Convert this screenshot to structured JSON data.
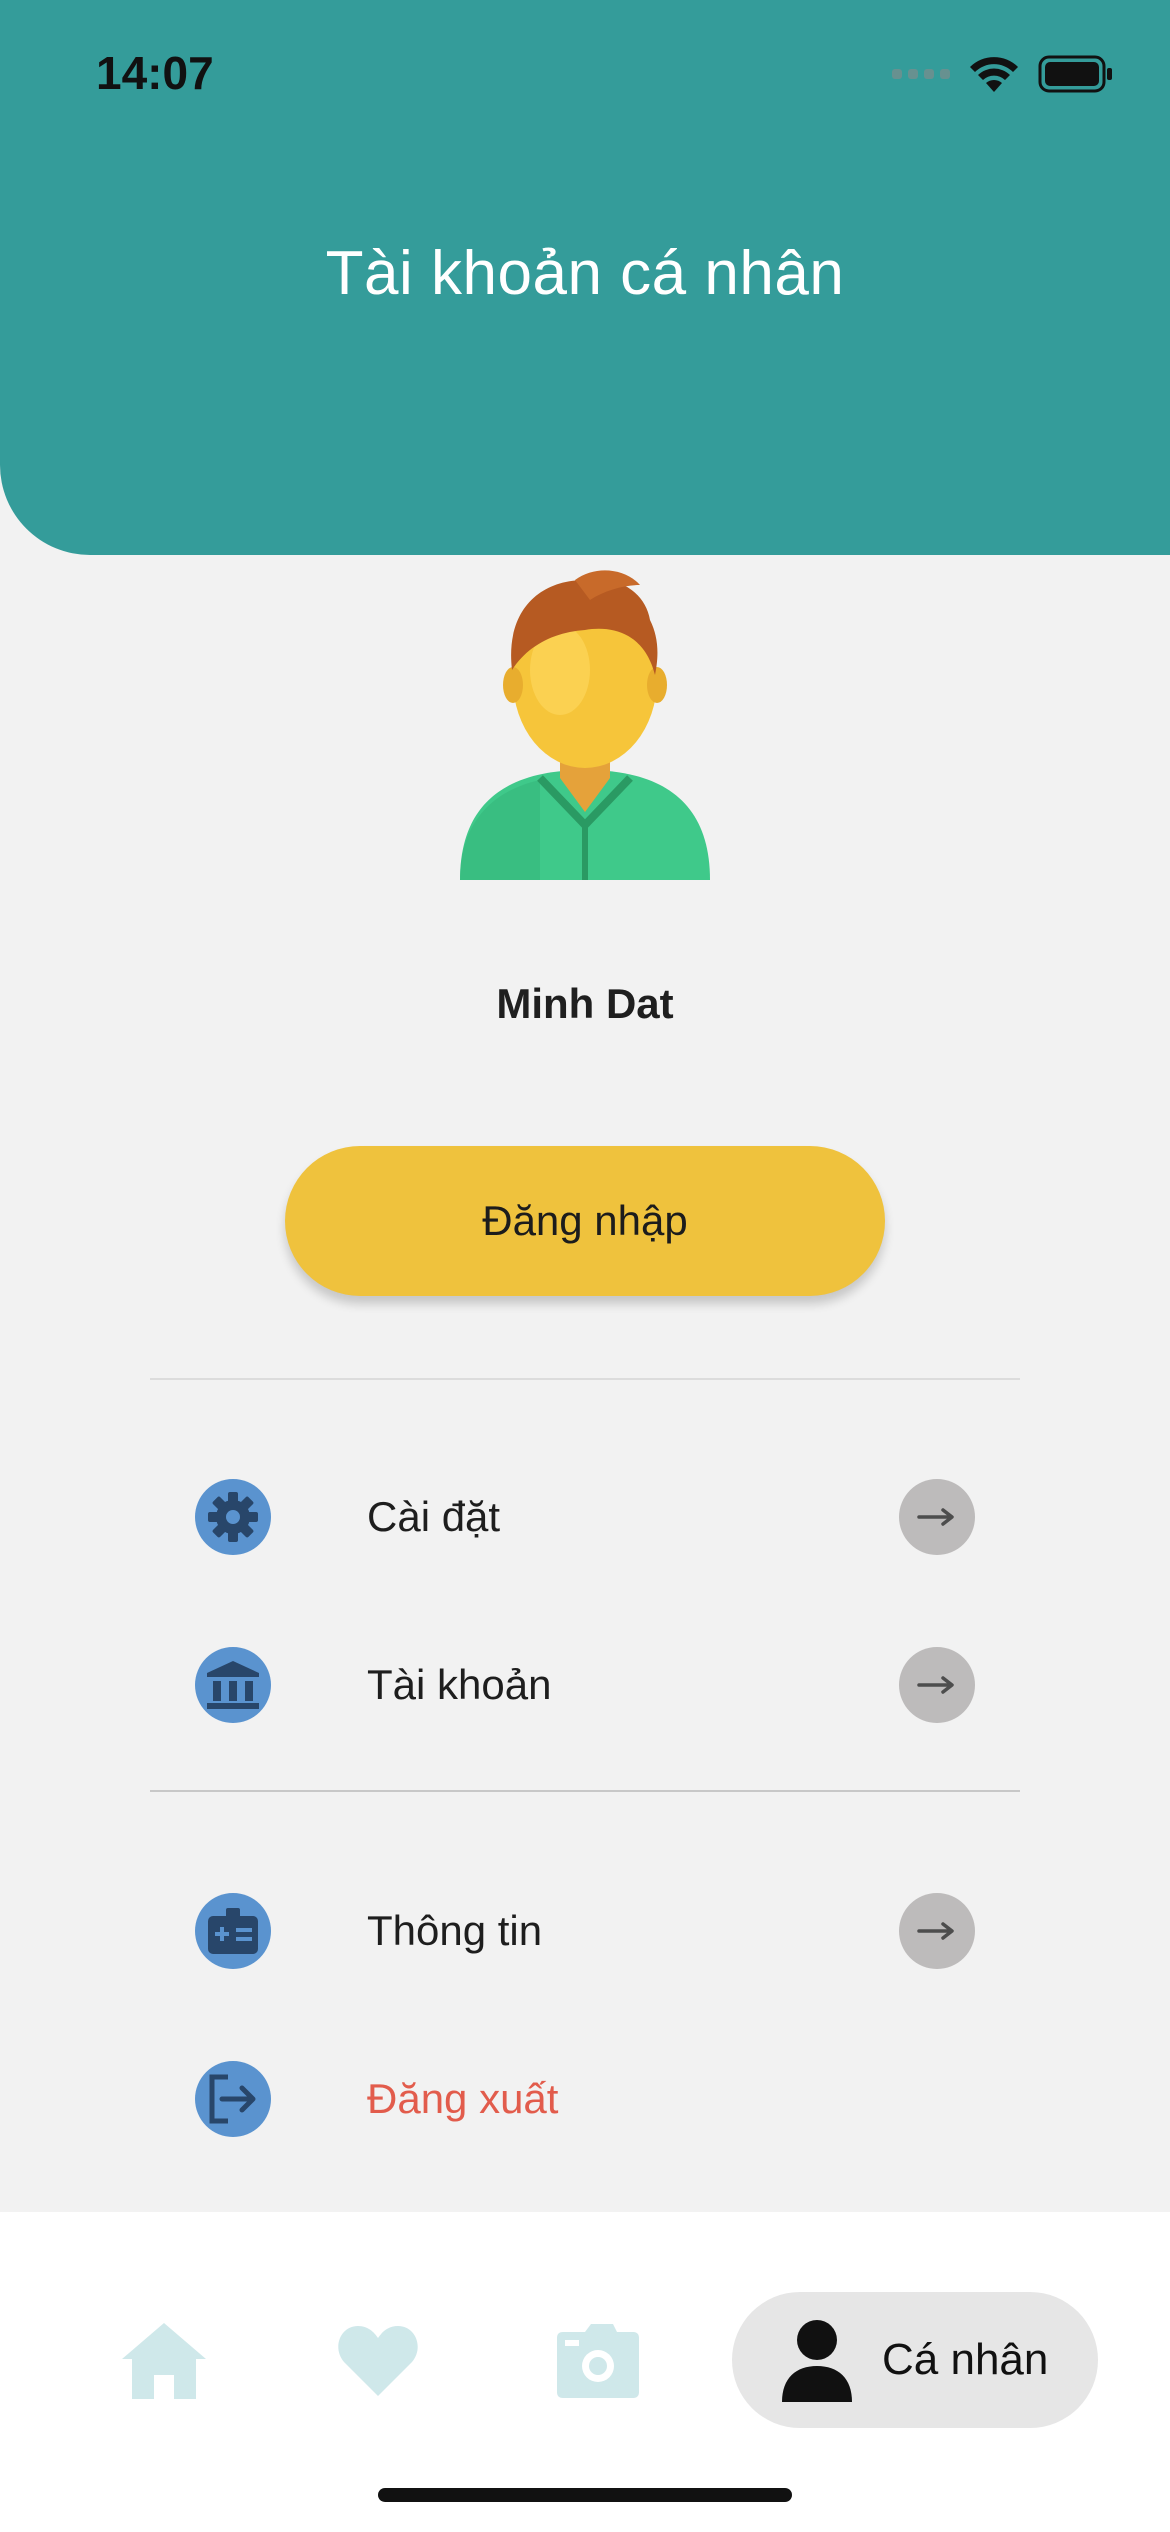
{
  "status_bar": {
    "time": "14:07"
  },
  "header": {
    "title": "Tài khoản cá nhân",
    "background": "#349c9a"
  },
  "profile": {
    "name": "Minh Dat",
    "avatar_icon": "user-avatar-illustration"
  },
  "login_button": {
    "label": "Đăng nhập",
    "color": "#efc23d"
  },
  "menu": {
    "settings": {
      "label": "Cài đặt",
      "icon": "gear-icon"
    },
    "account": {
      "label": "Tài khoản",
      "icon": "bank-icon"
    },
    "info": {
      "label": "Thông tin",
      "icon": "id-card-icon"
    },
    "logout": {
      "label": "Đăng xuất",
      "icon": "logout-icon",
      "color": "#e25c4c"
    }
  },
  "tabbar": {
    "tabs": [
      {
        "icon": "home-icon"
      },
      {
        "icon": "heart-icon"
      },
      {
        "icon": "camera-icon"
      },
      {
        "icon": "person-icon",
        "label": "Cá nhân",
        "active": true
      }
    ]
  }
}
